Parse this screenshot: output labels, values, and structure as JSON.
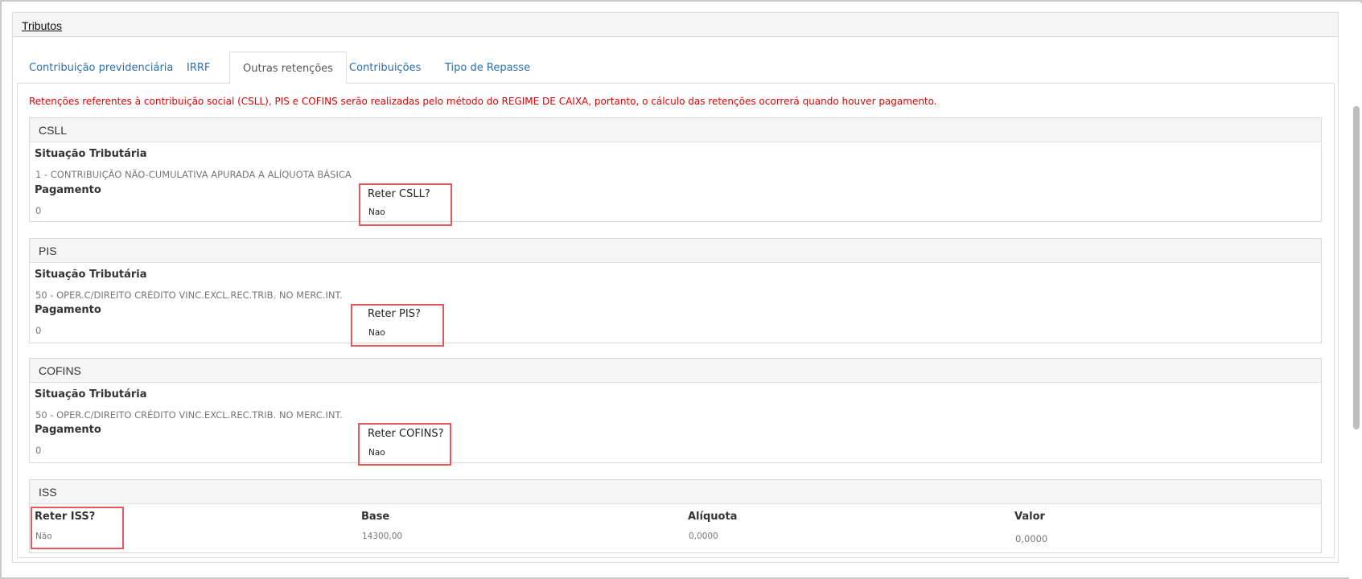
{
  "panel": {
    "title": "Tributos"
  },
  "tabs": [
    {
      "label": "Contribuição previdenciária",
      "active": false
    },
    {
      "label": "IRRF",
      "active": false
    },
    {
      "label": "Outras retenções",
      "active": true
    },
    {
      "label": "Contribuições",
      "active": false
    },
    {
      "label": "Tipo de Repasse",
      "active": false
    }
  ],
  "notice": "Retenções referentes à contribuição social (CSLL), PIS e COFINS serão realizadas pelo método do REGIME DE CAIXA, portanto, o cálculo das retenções ocorrerá quando houver pagamento.",
  "csll": {
    "title": "CSLL",
    "situacao_label": "Situação Tributária",
    "situacao_value": "1 - CONTRIBUIÇÃO NÃO-CUMULATIVA APURADA A ALÍQUOTA BÁSICA",
    "pagamento_label": "Pagamento",
    "pagamento_value": "0",
    "reter_label": "Reter CSLL?",
    "reter_value": "Nao"
  },
  "pis": {
    "title": "PIS",
    "situacao_label": "Situação Tributária",
    "situacao_value": "50 - OPER.C/DIREITO CRÉDITO VINC.EXCL.REC.TRIB. NO MERC.INT.",
    "pagamento_label": "Pagamento",
    "pagamento_value": "0",
    "reter_label": "Reter PIS?",
    "reter_value": "Nao"
  },
  "cofins": {
    "title": "COFINS",
    "situacao_label": "Situação Tributária",
    "situacao_value": "50 - OPER.C/DIREITO CRÉDITO VINC.EXCL.REC.TRIB. NO MERC.INT.",
    "pagamento_label": "Pagamento",
    "pagamento_value": "0",
    "reter_label": "Reter COFINS?",
    "reter_value": "Nao"
  },
  "iss": {
    "title": "ISS",
    "reter_label": "Reter ISS?",
    "reter_value": "Não",
    "base_label": "Base",
    "base_value": "14300,00",
    "aliquota_label": "Alíquota",
    "aliquota_value": "0,0000",
    "valor_label": "Valor",
    "valor_value": "0,0000"
  }
}
